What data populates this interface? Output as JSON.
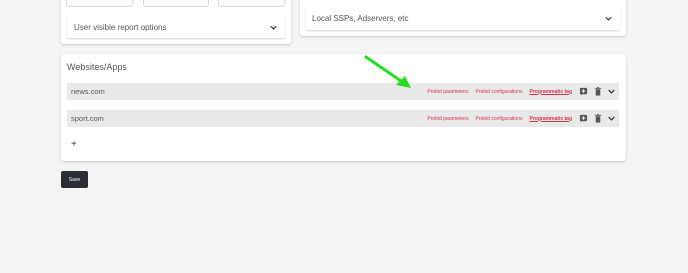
{
  "user_options": {
    "dropdown_label": "User visible report options"
  },
  "ssps": {
    "dropdown_label": "Local SSPs, Adservers, etc"
  },
  "websites": {
    "title": "Websites/Apps",
    "rows": [
      {
        "name": "news.com",
        "params_label": "Prebid parameters",
        "config_label": "Prebid configurations",
        "tag_label": "Programmatic tag"
      },
      {
        "name": "sport.com",
        "params_label": "Prebid parameters",
        "config_label": "Prebid configurations",
        "tag_label": "Programmatic tag"
      }
    ],
    "add_label": "+"
  },
  "save_label": "Save",
  "colors": {
    "accent_link": "#d6334d",
    "arrow": "#22dd22",
    "save_bg": "#2a2d33"
  },
  "icons": {
    "add_tag": "add-box-icon",
    "delete": "trash-icon",
    "expand": "chevron-down-icon",
    "annotation": "green-arrow-icon"
  }
}
